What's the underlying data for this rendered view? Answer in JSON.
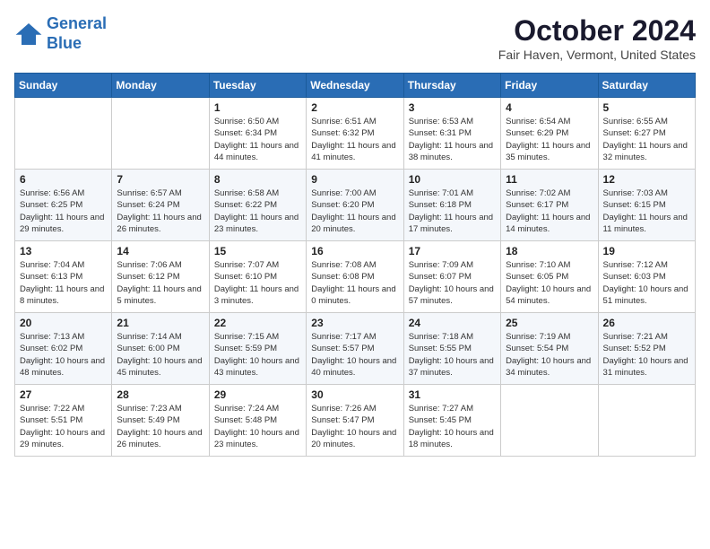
{
  "header": {
    "logo_line1": "General",
    "logo_line2": "Blue",
    "month": "October 2024",
    "location": "Fair Haven, Vermont, United States"
  },
  "days_of_week": [
    "Sunday",
    "Monday",
    "Tuesday",
    "Wednesday",
    "Thursday",
    "Friday",
    "Saturday"
  ],
  "weeks": [
    [
      {
        "day": "",
        "sunrise": "",
        "sunset": "",
        "daylight": ""
      },
      {
        "day": "",
        "sunrise": "",
        "sunset": "",
        "daylight": ""
      },
      {
        "day": "1",
        "sunrise": "Sunrise: 6:50 AM",
        "sunset": "Sunset: 6:34 PM",
        "daylight": "Daylight: 11 hours and 44 minutes."
      },
      {
        "day": "2",
        "sunrise": "Sunrise: 6:51 AM",
        "sunset": "Sunset: 6:32 PM",
        "daylight": "Daylight: 11 hours and 41 minutes."
      },
      {
        "day": "3",
        "sunrise": "Sunrise: 6:53 AM",
        "sunset": "Sunset: 6:31 PM",
        "daylight": "Daylight: 11 hours and 38 minutes."
      },
      {
        "day": "4",
        "sunrise": "Sunrise: 6:54 AM",
        "sunset": "Sunset: 6:29 PM",
        "daylight": "Daylight: 11 hours and 35 minutes."
      },
      {
        "day": "5",
        "sunrise": "Sunrise: 6:55 AM",
        "sunset": "Sunset: 6:27 PM",
        "daylight": "Daylight: 11 hours and 32 minutes."
      }
    ],
    [
      {
        "day": "6",
        "sunrise": "Sunrise: 6:56 AM",
        "sunset": "Sunset: 6:25 PM",
        "daylight": "Daylight: 11 hours and 29 minutes."
      },
      {
        "day": "7",
        "sunrise": "Sunrise: 6:57 AM",
        "sunset": "Sunset: 6:24 PM",
        "daylight": "Daylight: 11 hours and 26 minutes."
      },
      {
        "day": "8",
        "sunrise": "Sunrise: 6:58 AM",
        "sunset": "Sunset: 6:22 PM",
        "daylight": "Daylight: 11 hours and 23 minutes."
      },
      {
        "day": "9",
        "sunrise": "Sunrise: 7:00 AM",
        "sunset": "Sunset: 6:20 PM",
        "daylight": "Daylight: 11 hours and 20 minutes."
      },
      {
        "day": "10",
        "sunrise": "Sunrise: 7:01 AM",
        "sunset": "Sunset: 6:18 PM",
        "daylight": "Daylight: 11 hours and 17 minutes."
      },
      {
        "day": "11",
        "sunrise": "Sunrise: 7:02 AM",
        "sunset": "Sunset: 6:17 PM",
        "daylight": "Daylight: 11 hours and 14 minutes."
      },
      {
        "day": "12",
        "sunrise": "Sunrise: 7:03 AM",
        "sunset": "Sunset: 6:15 PM",
        "daylight": "Daylight: 11 hours and 11 minutes."
      }
    ],
    [
      {
        "day": "13",
        "sunrise": "Sunrise: 7:04 AM",
        "sunset": "Sunset: 6:13 PM",
        "daylight": "Daylight: 11 hours and 8 minutes."
      },
      {
        "day": "14",
        "sunrise": "Sunrise: 7:06 AM",
        "sunset": "Sunset: 6:12 PM",
        "daylight": "Daylight: 11 hours and 5 minutes."
      },
      {
        "day": "15",
        "sunrise": "Sunrise: 7:07 AM",
        "sunset": "Sunset: 6:10 PM",
        "daylight": "Daylight: 11 hours and 3 minutes."
      },
      {
        "day": "16",
        "sunrise": "Sunrise: 7:08 AM",
        "sunset": "Sunset: 6:08 PM",
        "daylight": "Daylight: 11 hours and 0 minutes."
      },
      {
        "day": "17",
        "sunrise": "Sunrise: 7:09 AM",
        "sunset": "Sunset: 6:07 PM",
        "daylight": "Daylight: 10 hours and 57 minutes."
      },
      {
        "day": "18",
        "sunrise": "Sunrise: 7:10 AM",
        "sunset": "Sunset: 6:05 PM",
        "daylight": "Daylight: 10 hours and 54 minutes."
      },
      {
        "day": "19",
        "sunrise": "Sunrise: 7:12 AM",
        "sunset": "Sunset: 6:03 PM",
        "daylight": "Daylight: 10 hours and 51 minutes."
      }
    ],
    [
      {
        "day": "20",
        "sunrise": "Sunrise: 7:13 AM",
        "sunset": "Sunset: 6:02 PM",
        "daylight": "Daylight: 10 hours and 48 minutes."
      },
      {
        "day": "21",
        "sunrise": "Sunrise: 7:14 AM",
        "sunset": "Sunset: 6:00 PM",
        "daylight": "Daylight: 10 hours and 45 minutes."
      },
      {
        "day": "22",
        "sunrise": "Sunrise: 7:15 AM",
        "sunset": "Sunset: 5:59 PM",
        "daylight": "Daylight: 10 hours and 43 minutes."
      },
      {
        "day": "23",
        "sunrise": "Sunrise: 7:17 AM",
        "sunset": "Sunset: 5:57 PM",
        "daylight": "Daylight: 10 hours and 40 minutes."
      },
      {
        "day": "24",
        "sunrise": "Sunrise: 7:18 AM",
        "sunset": "Sunset: 5:55 PM",
        "daylight": "Daylight: 10 hours and 37 minutes."
      },
      {
        "day": "25",
        "sunrise": "Sunrise: 7:19 AM",
        "sunset": "Sunset: 5:54 PM",
        "daylight": "Daylight: 10 hours and 34 minutes."
      },
      {
        "day": "26",
        "sunrise": "Sunrise: 7:21 AM",
        "sunset": "Sunset: 5:52 PM",
        "daylight": "Daylight: 10 hours and 31 minutes."
      }
    ],
    [
      {
        "day": "27",
        "sunrise": "Sunrise: 7:22 AM",
        "sunset": "Sunset: 5:51 PM",
        "daylight": "Daylight: 10 hours and 29 minutes."
      },
      {
        "day": "28",
        "sunrise": "Sunrise: 7:23 AM",
        "sunset": "Sunset: 5:49 PM",
        "daylight": "Daylight: 10 hours and 26 minutes."
      },
      {
        "day": "29",
        "sunrise": "Sunrise: 7:24 AM",
        "sunset": "Sunset: 5:48 PM",
        "daylight": "Daylight: 10 hours and 23 minutes."
      },
      {
        "day": "30",
        "sunrise": "Sunrise: 7:26 AM",
        "sunset": "Sunset: 5:47 PM",
        "daylight": "Daylight: 10 hours and 20 minutes."
      },
      {
        "day": "31",
        "sunrise": "Sunrise: 7:27 AM",
        "sunset": "Sunset: 5:45 PM",
        "daylight": "Daylight: 10 hours and 18 minutes."
      },
      {
        "day": "",
        "sunrise": "",
        "sunset": "",
        "daylight": ""
      },
      {
        "day": "",
        "sunrise": "",
        "sunset": "",
        "daylight": ""
      }
    ]
  ]
}
